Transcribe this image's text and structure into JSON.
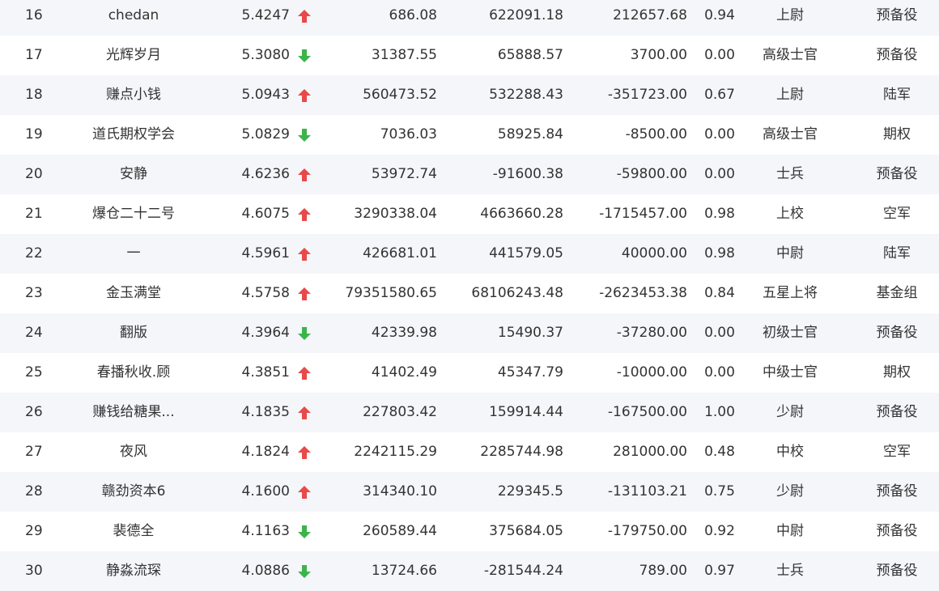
{
  "colors": {
    "up": "#e84a4a",
    "down": "#3bb54a"
  },
  "rows": [
    {
      "rank": "16",
      "name": "chedan",
      "score": "5.4247",
      "trend": "up",
      "v1": "686.08",
      "v2": "622091.18",
      "v3": "212657.68",
      "ratio": "0.94",
      "level": "上尉",
      "group": "预备役"
    },
    {
      "rank": "17",
      "name": "光辉岁月",
      "score": "5.3080",
      "trend": "down",
      "v1": "31387.55",
      "v2": "65888.57",
      "v3": "3700.00",
      "ratio": "0.00",
      "level": "高级士官",
      "group": "预备役"
    },
    {
      "rank": "18",
      "name": "赚点小钱",
      "score": "5.0943",
      "trend": "up",
      "v1": "560473.52",
      "v2": "532288.43",
      "v3": "-351723.00",
      "ratio": "0.67",
      "level": "上尉",
      "group": "陆军"
    },
    {
      "rank": "19",
      "name": "道氏期权学会",
      "score": "5.0829",
      "trend": "down",
      "v1": "7036.03",
      "v2": "58925.84",
      "v3": "-8500.00",
      "ratio": "0.00",
      "level": "高级士官",
      "group": "期权"
    },
    {
      "rank": "20",
      "name": "安静",
      "score": "4.6236",
      "trend": "up",
      "v1": "53972.74",
      "v2": "-91600.38",
      "v3": "-59800.00",
      "ratio": "0.00",
      "level": "士兵",
      "group": "预备役"
    },
    {
      "rank": "21",
      "name": "爆仓二十二号",
      "score": "4.6075",
      "trend": "up",
      "v1": "3290338.04",
      "v2": "4663660.28",
      "v3": "-1715457.00",
      "ratio": "0.98",
      "level": "上校",
      "group": "空军"
    },
    {
      "rank": "22",
      "name": "一",
      "score": "4.5961",
      "trend": "up",
      "v1": "426681.01",
      "v2": "441579.05",
      "v3": "40000.00",
      "ratio": "0.98",
      "level": "中尉",
      "group": "陆军"
    },
    {
      "rank": "23",
      "name": "金玉满堂",
      "score": "4.5758",
      "trend": "up",
      "v1": "79351580.65",
      "v2": "68106243.48",
      "v3": "-2623453.38",
      "ratio": "0.84",
      "level": "五星上将",
      "group": "基金组"
    },
    {
      "rank": "24",
      "name": "翻版",
      "score": "4.3964",
      "trend": "down",
      "v1": "42339.98",
      "v2": "15490.37",
      "v3": "-37280.00",
      "ratio": "0.00",
      "level": "初级士官",
      "group": "预备役"
    },
    {
      "rank": "25",
      "name": "春播秋收.顾",
      "score": "4.3851",
      "trend": "up",
      "v1": "41402.49",
      "v2": "45347.79",
      "v3": "-10000.00",
      "ratio": "0.00",
      "level": "中级士官",
      "group": "期权"
    },
    {
      "rank": "26",
      "name": "赚钱给糖果...",
      "score": "4.1835",
      "trend": "up",
      "v1": "227803.42",
      "v2": "159914.44",
      "v3": "-167500.00",
      "ratio": "1.00",
      "level": "少尉",
      "group": "预备役"
    },
    {
      "rank": "27",
      "name": "夜风",
      "score": "4.1824",
      "trend": "up",
      "v1": "2242115.29",
      "v2": "2285744.98",
      "v3": "281000.00",
      "ratio": "0.48",
      "level": "中校",
      "group": "空军"
    },
    {
      "rank": "28",
      "name": "赣劲资本6",
      "score": "4.1600",
      "trend": "up",
      "v1": "314340.10",
      "v2": "229345.5",
      "v3": "-131103.21",
      "ratio": "0.75",
      "level": "少尉",
      "group": "预备役"
    },
    {
      "rank": "29",
      "name": "裴德全",
      "score": "4.1163",
      "trend": "down",
      "v1": "260589.44",
      "v2": "375684.05",
      "v3": "-179750.00",
      "ratio": "0.92",
      "level": "中尉",
      "group": "预备役"
    },
    {
      "rank": "30",
      "name": "静淼流琛",
      "score": "4.0886",
      "trend": "down",
      "v1": "13724.66",
      "v2": "-281544.24",
      "v3": "789.00",
      "ratio": "0.97",
      "level": "士兵",
      "group": "预备役"
    }
  ]
}
